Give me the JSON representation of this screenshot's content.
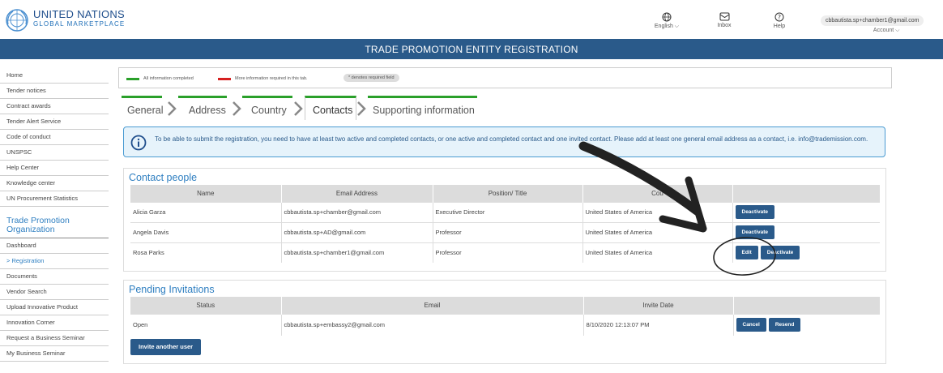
{
  "header": {
    "org_name": "UNITED NATIONS",
    "org_sub": "GLOBAL MARKETPLACE",
    "language_label": "English ⌵",
    "inbox_label": "Inbox",
    "help_label": "Help",
    "account_email": "cbbautista.sp+chamber1@gmail.com",
    "account_label": "Account ⌵"
  },
  "page_title": "TRADE PROMOTION ENTITY REGISTRATION",
  "sidebar": {
    "items": [
      "Home",
      "Tender notices",
      "Contract awards",
      "Tender Alert Service",
      "Code of conduct",
      "UNSPSC",
      "Help Center",
      "Knowledge center",
      "UN Procurement Statistics"
    ],
    "section_title": "Trade Promotion Organization",
    "section_items": [
      "Dashboard",
      "> Registration",
      "Documents",
      "Vendor Search",
      "Upload Innovative Product",
      "Innovation Corner",
      "Request a Business Seminar",
      "My Business Seminar"
    ]
  },
  "legend": {
    "complete": "All information completed",
    "incomplete": "More information required in this tab.",
    "required_note": "* denotes required field",
    "complete_color": "#2aa02a",
    "incomplete_color": "#d62020"
  },
  "tabs": [
    "General",
    "Address",
    "Country",
    "Contacts",
    "Supporting information"
  ],
  "info_message": "To be able to submit the registration, you need to have at least two active and completed contacts, or one active and completed contact and one invited contact. Please add at least one general email address as a contact, i.e. info@trademission.com.",
  "contacts": {
    "title": "Contact people",
    "headers": [
      "Name",
      "Email Address",
      "Position/ Title",
      "Cou",
      ""
    ],
    "rows": [
      {
        "name": "Alicia Garza",
        "email": "cbbautista.sp+chamber@gmail.com",
        "position": "Executive Director",
        "country": "United States of America",
        "actions": [
          "Deactivate"
        ]
      },
      {
        "name": "Angela Davis",
        "email": "cbbautista.sp+AD@gmail.com",
        "position": "Professor",
        "country": "United States of America",
        "actions": [
          "Deactivate"
        ]
      },
      {
        "name": "Rosa Parks",
        "email": "cbbautista.sp+chamber1@gmail.com",
        "position": "Professor",
        "country": "United States of America",
        "actions": [
          "Edit",
          "Deactivate"
        ]
      }
    ]
  },
  "invitations": {
    "title": "Pending Invitations",
    "headers": [
      "Status",
      "Email",
      "Invite Date",
      ""
    ],
    "rows": [
      {
        "status": "Open",
        "email": "cbbautista.sp+embassy2@gmail.com",
        "date": "8/10/2020 12:13:07 PM",
        "actions": [
          "Cancel",
          "Resend"
        ]
      }
    ],
    "invite_button": "Invite another user"
  }
}
